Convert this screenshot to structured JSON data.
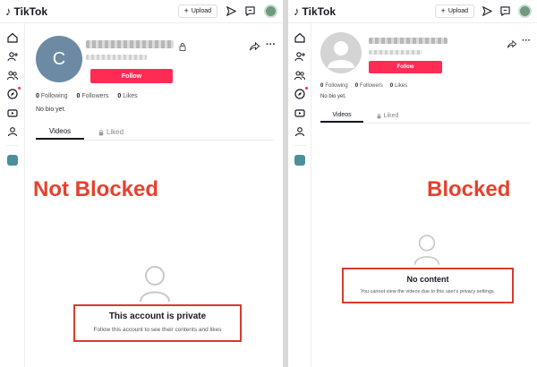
{
  "not_blocked": {
    "topbar": {
      "logo": "TikTok",
      "upload_label": "Upload"
    },
    "profile": {
      "avatar_letter": "C",
      "follow_label": "Follow",
      "following_count": "0",
      "following_label": "Following",
      "followers_count": "0",
      "followers_label": "Followers",
      "likes_count": "0",
      "likes_label": "Likes",
      "bio": "No bio yet."
    },
    "tabs": {
      "videos": "Videos",
      "liked": "Liked"
    },
    "label": "Not Blocked",
    "message": {
      "title": "This account is private",
      "subtitle": "Follow this account to see their contents and likes"
    }
  },
  "blocked": {
    "topbar": {
      "logo": "TikTok",
      "upload_label": "Upload"
    },
    "profile": {
      "follow_label": "Follow",
      "following_count": "0",
      "following_label": "Following",
      "followers_count": "0",
      "followers_label": "Followers",
      "likes_count": "0",
      "likes_label": "Likes",
      "bio": "No bio yet."
    },
    "tabs": {
      "videos": "Videos",
      "liked": "Liked"
    },
    "label": "Blocked",
    "message": {
      "title": "No content",
      "subtitle": "You cannot view the videos due to this user's privacy settings."
    }
  },
  "colors": {
    "accent": "#fe2c55",
    "annotation": "#e8402e",
    "highlight_box": "#d83a2f"
  }
}
